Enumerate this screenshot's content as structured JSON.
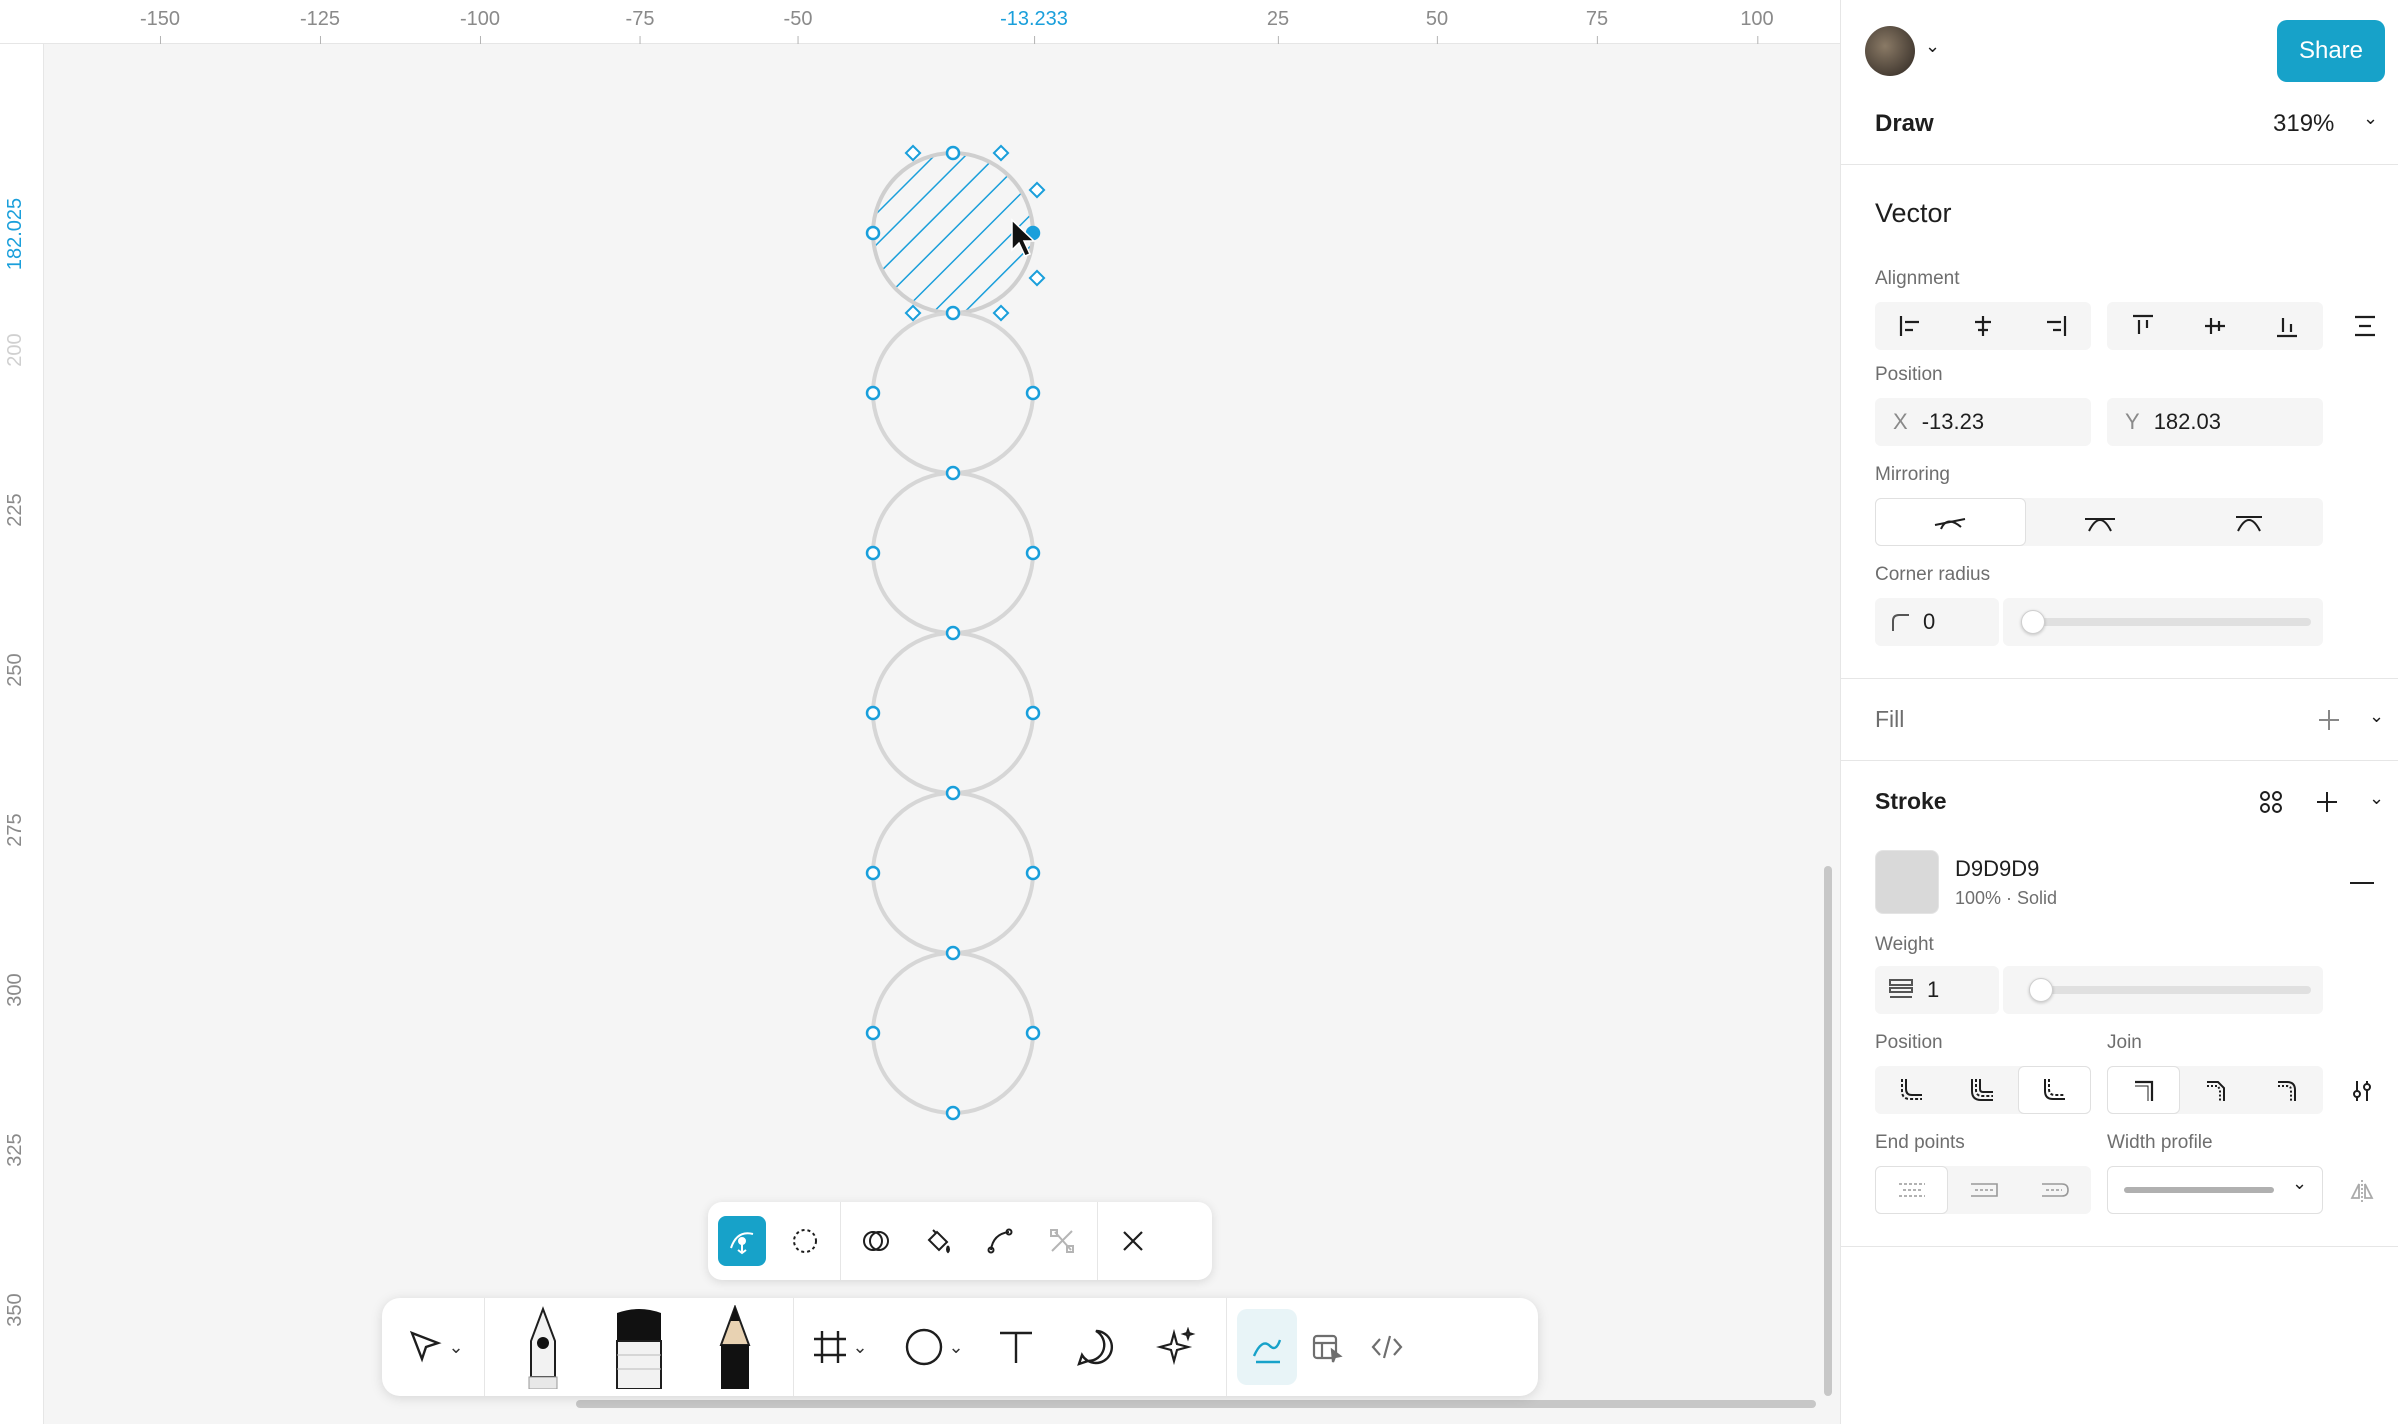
{
  "ruler": {
    "top_ticks": [
      "-150",
      "-125",
      "-100",
      "-75",
      "-50",
      "-13.233",
      "25",
      "50",
      "75",
      "100"
    ],
    "left_ticks": [
      "182.025",
      "200",
      "225",
      "250",
      "275",
      "300",
      "325",
      "350"
    ]
  },
  "header": {
    "page_name": "Draw",
    "zoom": "319%",
    "share_label": "Share"
  },
  "panel": {
    "title": "Vector",
    "alignment_label": "Alignment",
    "position_label": "Position",
    "x_label": "X",
    "x_value": "-13.23",
    "y_label": "Y",
    "y_value": "182.03",
    "mirroring_label": "Mirroring",
    "corner_radius_label": "Corner radius",
    "corner_radius_value": "0",
    "fill_label": "Fill",
    "stroke_label": "Stroke",
    "stroke_color_hex": "D9D9D9",
    "stroke_color_detail": "100% · Solid",
    "weight_label": "Weight",
    "weight_value": "1",
    "stroke_position_label": "Position",
    "join_label": "Join",
    "end_points_label": "End points",
    "width_profile_label": "Width profile"
  },
  "colors": {
    "accent": "#17a2c9",
    "selection": "#1a9fdb",
    "stroke_swatch": "#D9D9D9"
  },
  "icons": {
    "vector_toolbar": [
      "bend-tool-icon",
      "lasso-icon",
      "shape-builder-icon",
      "paint-bucket-icon",
      "curve-icon",
      "cut-icon",
      "close-icon"
    ],
    "main_toolbar": [
      "move-icon",
      "pen-icon",
      "brush-icon",
      "pencil-icon",
      "frame-icon",
      "ellipse-icon",
      "text-icon",
      "comment-icon",
      "ai-sparkle-icon",
      "draw-mode-icon",
      "dev-mode-icon",
      "code-icon"
    ]
  }
}
